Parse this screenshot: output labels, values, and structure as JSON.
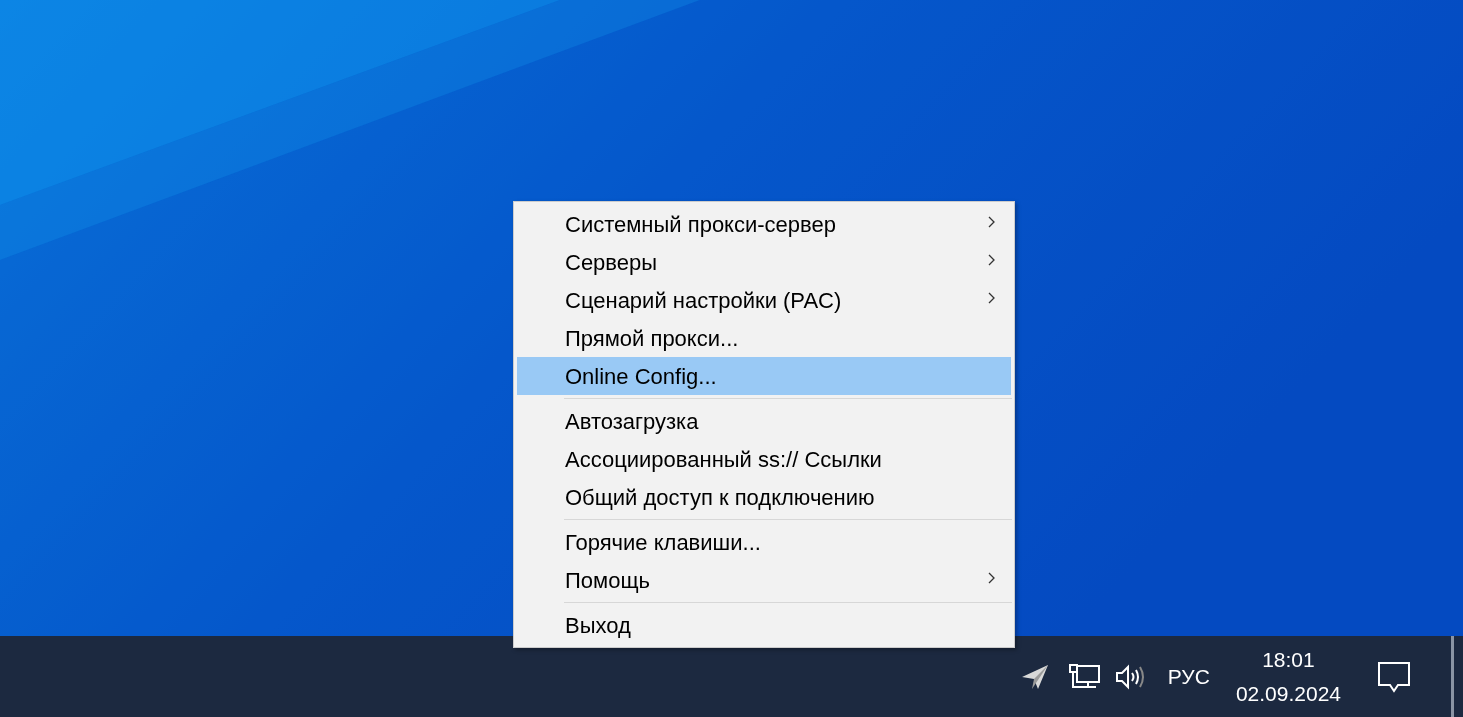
{
  "context_menu": {
    "sections": [
      [
        {
          "label": "Системный прокси-сервер",
          "has_submenu": true,
          "selected": false
        },
        {
          "label": "Серверы",
          "has_submenu": true,
          "selected": false
        },
        {
          "label": "Сценарий настройки (PAC)",
          "has_submenu": true,
          "selected": false
        },
        {
          "label": "Прямой прокси...",
          "has_submenu": false,
          "selected": false
        },
        {
          "label": "Online Config...",
          "has_submenu": false,
          "selected": true
        }
      ],
      [
        {
          "label": "Автозагрузка",
          "has_submenu": false,
          "selected": false
        },
        {
          "label": "Ассоциированный ss:// Ссылки",
          "has_submenu": false,
          "selected": false
        },
        {
          "label": "Общий доступ к подключению",
          "has_submenu": false,
          "selected": false
        }
      ],
      [
        {
          "label": "Горячие клавиши...",
          "has_submenu": false,
          "selected": false
        },
        {
          "label": "Помощь",
          "has_submenu": true,
          "selected": false
        }
      ],
      [
        {
          "label": "Выход",
          "has_submenu": false,
          "selected": false
        }
      ]
    ]
  },
  "taskbar": {
    "language": "РУС",
    "time": "18:01",
    "date": "02.09.2024"
  }
}
